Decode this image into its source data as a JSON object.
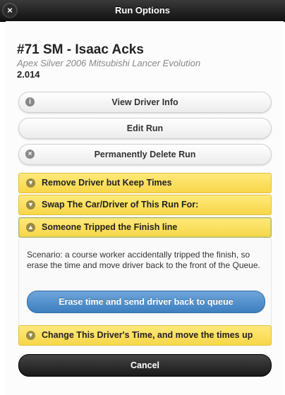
{
  "window": {
    "title": "Run Options"
  },
  "driver": {
    "heading": "#71 SM - Isaac Acks",
    "car": "Apex Silver 2006 Mitsubishi Lancer Evolution",
    "time": "2.014"
  },
  "buttons": {
    "view_driver_info": "View Driver Info",
    "edit_run": "Edit Run",
    "delete_run": "Permanently Delete Run"
  },
  "accordions": [
    {
      "label": "Remove Driver but Keep Times"
    },
    {
      "label": "Swap The Car/Driver of This Run For:"
    },
    {
      "label": "Someone Tripped the Finish line"
    },
    {
      "label": "Change This Driver's Time, and move the times up"
    }
  ],
  "scenario": {
    "text": "Scenario: a course worker accidentally tripped the finish, so erase the time and move driver back to the front of the Queue.",
    "action_label": "Erase time and send driver back to queue"
  },
  "footer": {
    "cancel_label": "Cancel"
  },
  "icons": {
    "close": "close-icon",
    "info": "info-icon",
    "delete": "delete-icon",
    "chevron_down": "chevron-down-icon",
    "chevron_up": "chevron-up-icon"
  }
}
